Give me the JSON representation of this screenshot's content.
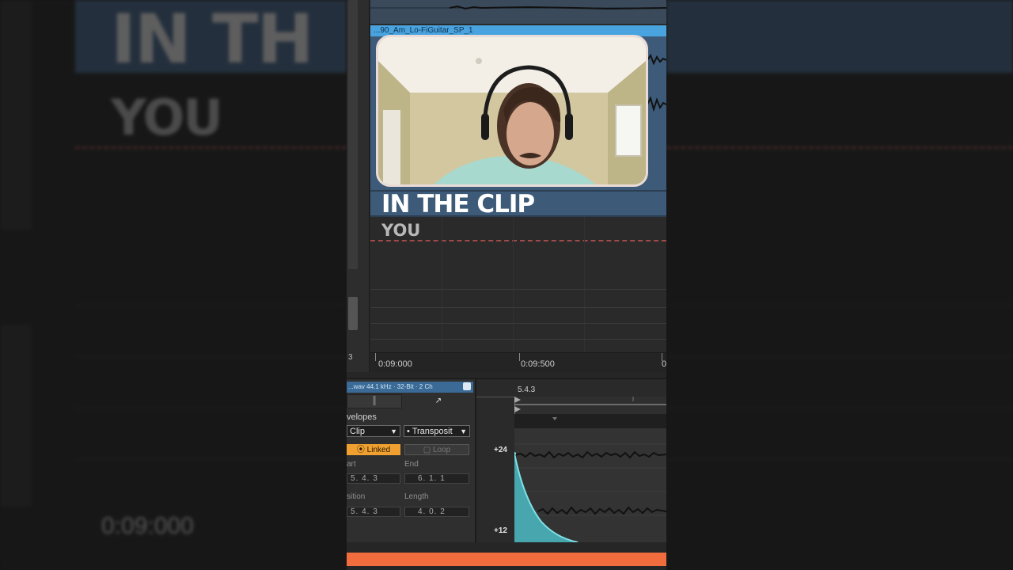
{
  "background": {
    "big_text_1": "IN TH",
    "big_text_2": "YOU",
    "time_label": "0:09:000"
  },
  "arrangement": {
    "clip_name": "...90_Am_Lo-FiGuitar_SP_1",
    "timeline_ticks": [
      "0:09:000",
      "0:09:500",
      "0:"
    ],
    "left_rail_label": "3"
  },
  "overlay": {
    "title": "IN THE CLIP",
    "subtitle": "YOU"
  },
  "clip_view": {
    "file_info": "...wav   44.1 kHz · 32-Bit · 2 Ch",
    "envelopes_label": "velopes",
    "device_select": "Clip",
    "control_select": "• Transposit",
    "linked_button": "Linked",
    "loop_button": "Loop",
    "start_label": "art",
    "end_label": "End",
    "start_value": "5.  4.  3",
    "end_value": "6.  1.  1",
    "position_label": "sition",
    "length_label": "Length",
    "position_value": "5.  4.  3",
    "length_value": "4.  0.  2",
    "ruler_position": "5.4.3",
    "axis_top": "+24",
    "axis_bottom": "+12"
  },
  "colors": {
    "clip_blue": "#49a3df",
    "linked_orange": "#f0a030",
    "envelope_teal": "#58c9cf",
    "bottom_bar": "#f26d3d"
  }
}
